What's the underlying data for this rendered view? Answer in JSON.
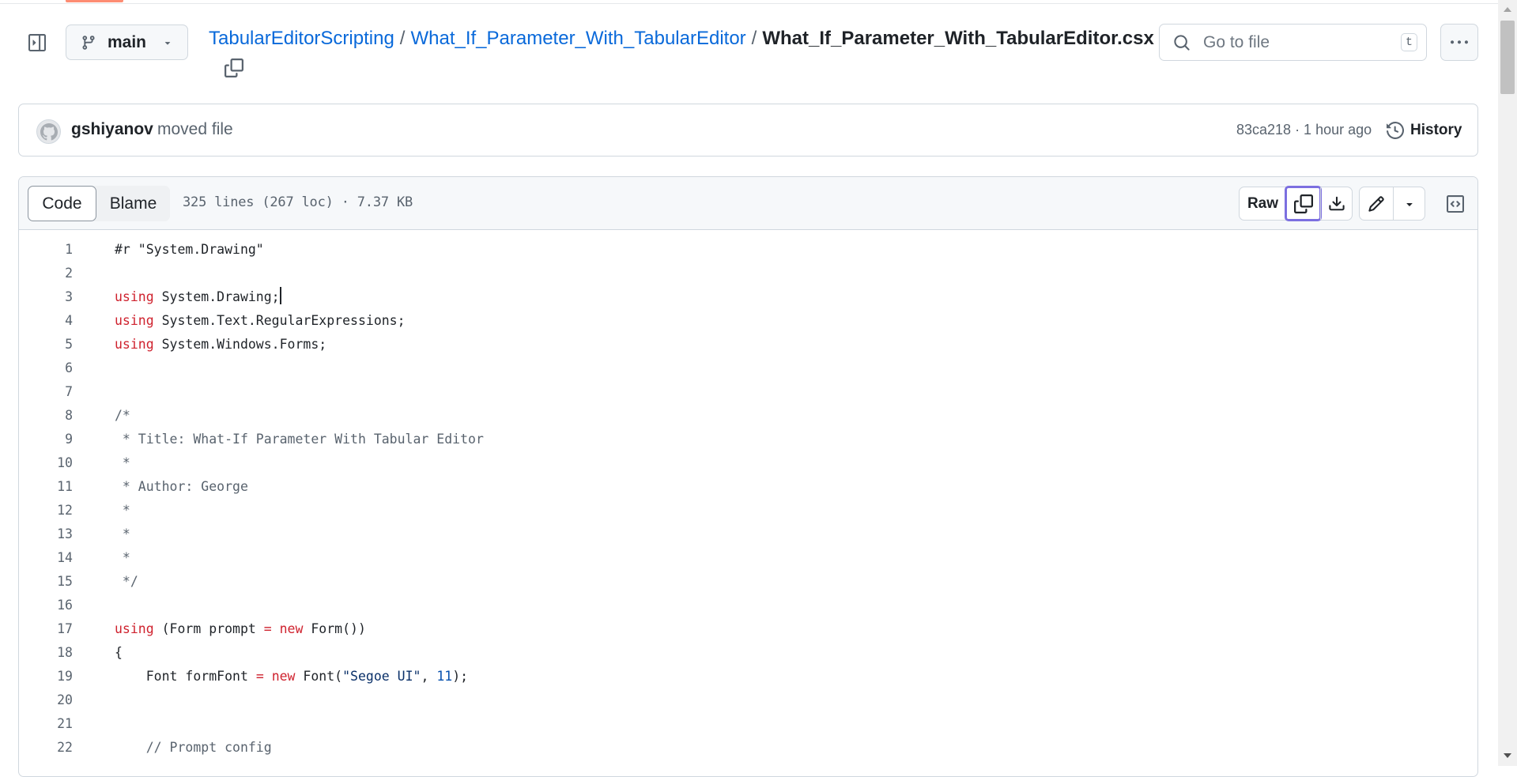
{
  "repo_header": {
    "branch": "main",
    "breadcrumb": {
      "repo": "TabularEditorScripting",
      "folder": "What_If_Parameter_With_TabularEditor",
      "file": "What_If_Parameter_With_TabularEditor.csx",
      "separator": "/"
    },
    "search": {
      "placeholder": "Go to file",
      "shortcut": "t"
    }
  },
  "commit": {
    "author": "gshiyanov",
    "message": "moved file",
    "meta": "83ca218 · 1 hour ago",
    "history_label": "History"
  },
  "file_header": {
    "tabs": [
      "Code",
      "Blame"
    ],
    "active_tab": "Code",
    "info": "325 lines (267 loc) · 7.37 KB",
    "raw_label": "Raw"
  },
  "code_lines": [
    "#r \"System.Drawing\"",
    "",
    "using System.Drawing;",
    "using System.Text.RegularExpressions;",
    "using System.Windows.Forms;",
    "",
    "",
    "/*",
    " * Title: What-If Parameter With Tabular Editor",
    " *",
    " * Author: George",
    " *",
    " *",
    " *",
    " */",
    "",
    "using (Form prompt = new Form())",
    "{",
    "    Font formFont = new Font(\"Segoe UI\", 11);",
    "",
    "",
    "    // Prompt config"
  ],
  "colors": {
    "link": "#0969da",
    "keyword": "#cf222e",
    "string": "#0a3069",
    "number": "#0550ae",
    "comment": "#59636e",
    "focus_outline": "#7c6fe0",
    "tab_accent": "#fd8c73"
  },
  "icons": {
    "sidebar_toggle": "sidebar-expand-icon",
    "branch": "git-branch-icon",
    "copy_path": "copy-icon",
    "search": "search-icon",
    "more": "kebab-horizontal-icon",
    "history": "history-icon",
    "copy_raw": "copy-icon",
    "download": "download-icon",
    "edit": "pencil-icon",
    "symbols": "code-square-icon"
  }
}
